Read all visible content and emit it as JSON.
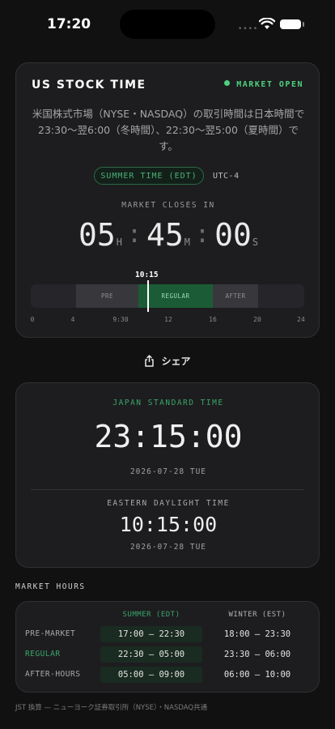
{
  "status_bar": {
    "time": "17:20",
    "dots": "••••"
  },
  "card": {
    "title": "US STOCK TIME",
    "market_status": "MARKET OPEN",
    "description": "米国株式市場（NYSE・NASDAQ）の取引時間は日本時間で23:30〜翌6:00（冬時間）、22:30〜翌5:00（夏時間）です。",
    "season_pill": "SUMMER TIME (EDT)",
    "utc_offset": "UTC-4",
    "countdown_label": "MARKET CLOSES IN",
    "countdown": {
      "hours": "05",
      "minutes": "45",
      "seconds": "00",
      "h_unit": "H",
      "m_unit": "M",
      "s_unit": "S",
      "separator": ":"
    },
    "timeline": {
      "now_label": "10:15",
      "segments": {
        "pre": "PRE",
        "regular": "REGULAR",
        "after": "AFTER"
      },
      "ticks": [
        "0",
        "4",
        "9:30",
        "12",
        "16",
        "20",
        "24"
      ]
    }
  },
  "share_label": "シェア",
  "clock": {
    "jst_label": "JAPAN STANDARD TIME",
    "jst_time": "23:15:00",
    "jst_date": "2026-07-28 TUE",
    "edt_label": "EASTERN DAYLIGHT TIME",
    "edt_time": "10:15:00",
    "edt_date": "2026-07-28 TUE"
  },
  "market_hours": {
    "title": "MARKET HOURS",
    "summer_header": "SUMMER (EDT)",
    "winter_header": "WINTER (EST)",
    "rows": [
      {
        "label": "PRE-MARKET",
        "summer": "17:00 — 22:30",
        "winter": "18:00 — 23:30"
      },
      {
        "label": "REGULAR",
        "summer": "22:30 — 05:00",
        "winter": "23:30 — 06:00"
      },
      {
        "label": "AFTER-HOURS",
        "summer": "05:00 — 09:00",
        "winter": "06:00 — 10:00"
      }
    ]
  },
  "footer": "JST 換算 — ニューヨーク証券取引所（NYSE）・NASDAQ共通",
  "colors": {
    "accent_green": "#4ecf7e",
    "regular_bar": "#1b5c36",
    "background": "#111112"
  }
}
